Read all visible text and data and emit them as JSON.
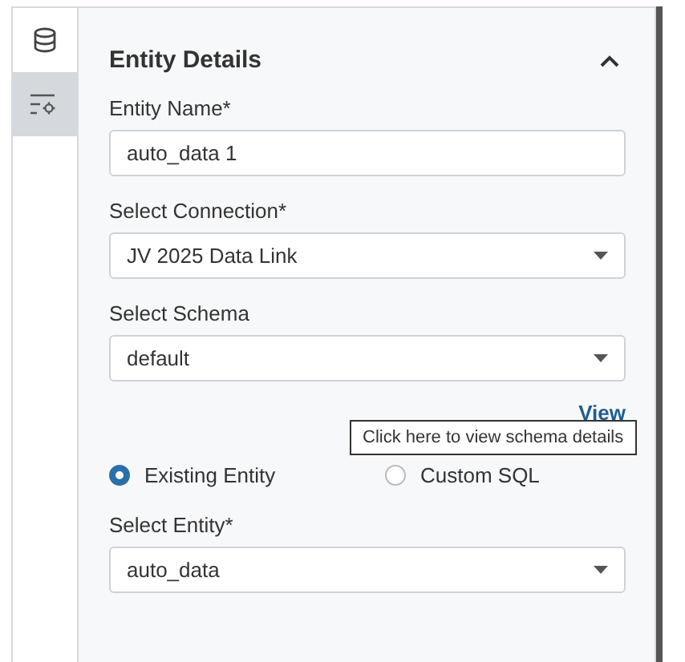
{
  "sidebar": {
    "tabs": [
      {
        "kind": "database",
        "selected": false
      },
      {
        "kind": "filter",
        "selected": true
      }
    ]
  },
  "panel": {
    "title": "Entity Details",
    "expanded": true,
    "fields": [
      {
        "kind": "text",
        "label": "Entity Name*",
        "value": "auto_data 1"
      },
      {
        "kind": "select",
        "label": "Select Connection*",
        "value": "JV 2025 Data Link"
      },
      {
        "kind": "select",
        "label": "Select Schema",
        "value": "default"
      }
    ],
    "link": "View",
    "tooltip": "Click here to view schema details",
    "source_options": [
      {
        "label": "Existing Entity",
        "selected": true
      },
      {
        "label": "Custom SQL",
        "selected": false
      }
    ],
    "entity_field": {
      "kind": "select",
      "label": "Select Entity*",
      "value": "auto_data"
    }
  }
}
